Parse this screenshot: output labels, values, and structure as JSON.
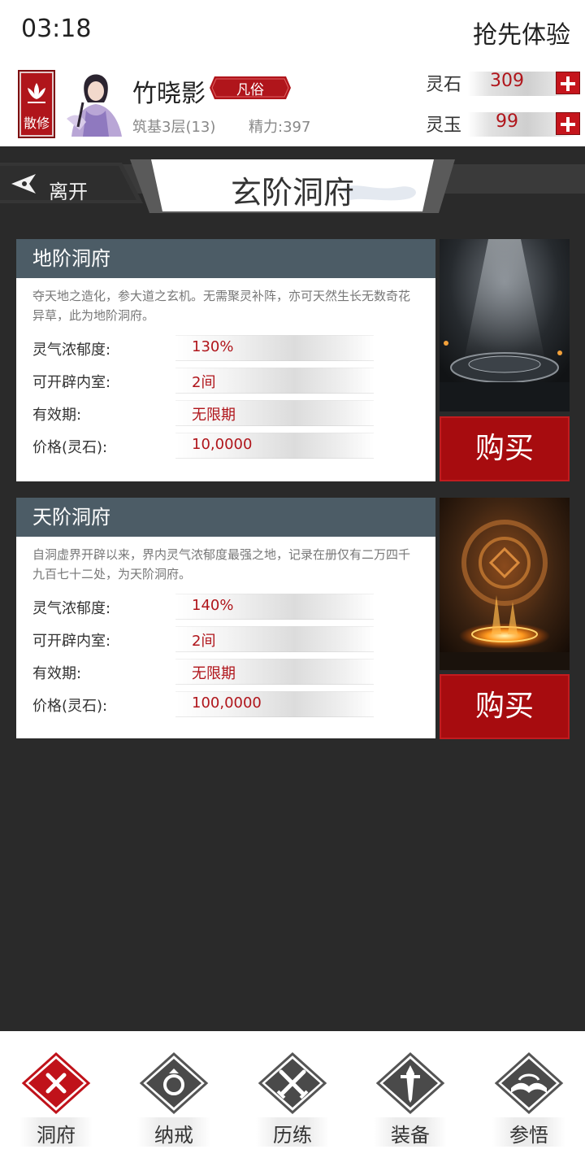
{
  "status_bar": {
    "time": "03:18",
    "right_text": "抢先体验"
  },
  "player": {
    "rank_badge": "散修",
    "name": "竹晓影",
    "realm_tag": "凡俗",
    "level": "筑基3层(13)",
    "energy": "精力:397"
  },
  "currencies": [
    {
      "label": "灵石",
      "value": "309"
    },
    {
      "label": "灵玉",
      "value": "99"
    }
  ],
  "nav_bar": {
    "leave_label": "离开",
    "title": "玄阶洞府"
  },
  "cards": [
    {
      "title": "地阶洞府",
      "description": "夺天地之造化，参大道之玄机。无需聚灵补阵，亦可天然生长无数奇花异草，此为地阶洞府。",
      "props": [
        {
          "label": "灵气浓郁度:",
          "value": "130%"
        },
        {
          "label": "可开辟内室:",
          "value": "2间"
        },
        {
          "label": "有效期:",
          "value": "无限期"
        },
        {
          "label": "价格(灵石):",
          "value": "10,0000"
        }
      ],
      "buy_label": "购买"
    },
    {
      "title": "天阶洞府",
      "description": "自洞虚界开辟以来，界内灵气浓郁度最强之地，记录在册仅有二万四千九百七十二处，为天阶洞府。",
      "props": [
        {
          "label": "灵气浓郁度:",
          "value": "140%"
        },
        {
          "label": "可开辟内室:",
          "value": "2间"
        },
        {
          "label": "有效期:",
          "value": "无限期"
        },
        {
          "label": "价格(灵石):",
          "value": "100,0000"
        }
      ],
      "buy_label": "购买"
    }
  ],
  "bottom_nav": [
    {
      "label": "洞府",
      "icon": "cave-icon",
      "active": true
    },
    {
      "label": "纳戒",
      "icon": "ring-icon",
      "active": false
    },
    {
      "label": "历练",
      "icon": "crossed-swords-icon",
      "active": false
    },
    {
      "label": "装备",
      "icon": "sword-icon",
      "active": false
    },
    {
      "label": "参悟",
      "icon": "open-book-icon",
      "active": false
    }
  ],
  "colors": {
    "accent_red": "#b0151b",
    "card_header": "#4c5c66",
    "background": "#2a2a2a"
  }
}
